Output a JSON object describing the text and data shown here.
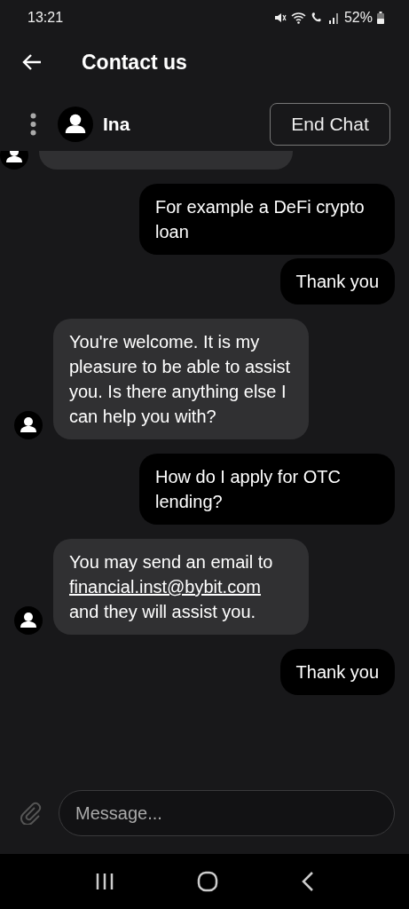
{
  "status_bar": {
    "time": "13:21",
    "battery": "52%"
  },
  "header": {
    "title": "Contact us"
  },
  "agent": {
    "name": "Ina",
    "end_button": "End Chat"
  },
  "messages": [
    {
      "kind": "partial"
    },
    {
      "kind": "user",
      "parts": [
        {
          "text": "For example a DeFi crypto loan"
        }
      ]
    },
    {
      "kind": "user",
      "parts": [
        {
          "text": "Thank you"
        }
      ]
    },
    {
      "kind": "agent",
      "parts": [
        {
          "text": "You're welcome. It is my pleasure to be able to assist you. Is there anything else I can help you with?"
        }
      ]
    },
    {
      "kind": "user",
      "parts": [
        {
          "text": "How do I apply for OTC lending?"
        }
      ]
    },
    {
      "kind": "agent",
      "parts": [
        {
          "text": "You may send an email to "
        },
        {
          "text": "financial.inst@bybit.com",
          "kind": "link"
        },
        {
          "text": " and they will assist you."
        }
      ]
    },
    {
      "kind": "user",
      "parts": [
        {
          "text": "Thank you"
        }
      ]
    }
  ],
  "composer": {
    "placeholder": "Message..."
  }
}
